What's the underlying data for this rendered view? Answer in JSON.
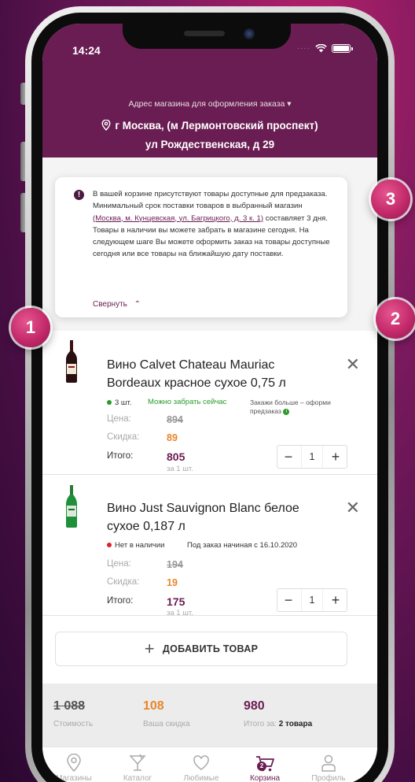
{
  "status_bar": {
    "time": "14:24",
    "dots": "····"
  },
  "header": {
    "caption": "Адрес магазина для оформления заказа",
    "address_line1": "г Москва, (м  Лермонтовский проспект)",
    "address_line2": "ул Рождественская, д 29"
  },
  "notice": {
    "text_before": "В вашей корзине присутствуют товары доступные для предзаказа. Минимальный срок поставки товаров в выбранный магазин ",
    "link": "(Москва, м. Кунцевская, ул. Багрицкого, д. 3 к. 1)",
    "text_after": " составляет 3 дня. Товары в наличии вы можете забрать в магазине сегодня. На следующем шаге Вы можете оформить заказ на товары доступные сегодня  или все товары на ближайшую дату поставки.",
    "collapse_label": "Свернуть"
  },
  "items": [
    {
      "name": "Вино Calvet Chateau Mauriac Bordeaux красное сухое 0,75 л",
      "stock": "3 шт.",
      "pickup": "Можно забрать сейчас",
      "preorder_note": "Закажи больше – оформи предзаказ",
      "price_label": "Цена:",
      "price": "894",
      "discount_label": "Скидка:",
      "discount": "89",
      "total_label": "Итого:",
      "total": "805",
      "per_unit": "за 1 шт.",
      "qty": "1",
      "status_color": "#2a9a2a"
    },
    {
      "name": "Вино Just Sauvignon Blanc белое сухое 0,187 л",
      "stock": "Нет в наличии",
      "order_note": "Под заказ начиная с 16.10.2020",
      "price_label": "Цена:",
      "price": "194",
      "discount_label": "Скидка:",
      "discount": "19",
      "total_label": "Итого:",
      "total": "175",
      "per_unit": "за 1 шт.",
      "qty": "1",
      "status_color": "#e0202a"
    }
  ],
  "add_button_label": "ДОБАВИТЬ ТОВАР",
  "totals": {
    "cost": "1 088",
    "cost_label": "Стоимость",
    "discount": "108",
    "discount_label": "Ваша скидка",
    "total": "980",
    "total_label": "Итого за:",
    "total_count": "2 товара"
  },
  "tabs": [
    {
      "label": "Магазины",
      "icon": "map-pin-icon"
    },
    {
      "label": "Каталог",
      "icon": "cocktail-glass-icon"
    },
    {
      "label": "Любимые",
      "icon": "heart-icon"
    },
    {
      "label": "Корзина",
      "icon": "cart-icon",
      "badge": "2"
    },
    {
      "label": "Профиль",
      "icon": "person-icon"
    }
  ],
  "markers": [
    "1",
    "2",
    "3"
  ],
  "colors": {
    "brand": "#6a1d52",
    "orange": "#e8862a",
    "green": "#2a9a2a",
    "red": "#e0202a"
  }
}
